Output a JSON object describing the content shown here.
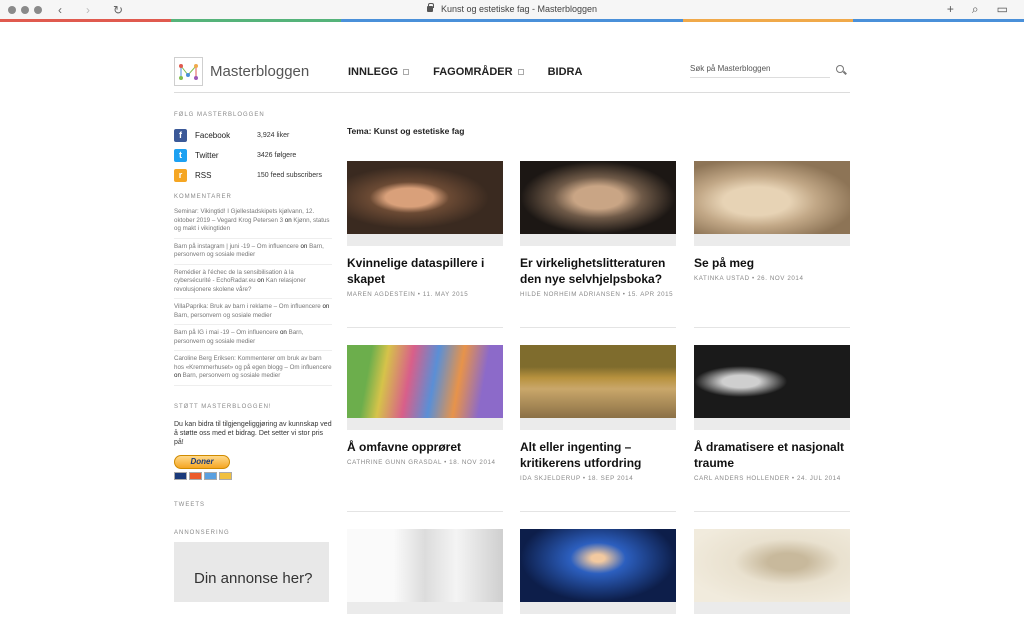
{
  "browser": {
    "tab_title": "Kunst og estetiske fag - Masterbloggen",
    "back": "‹",
    "forward": "›",
    "reload": "↻",
    "new_tab": "+",
    "search": "⌕",
    "sidebar_toggle": "▭",
    "colorbar": [
      "#e05a4f",
      "#55b37a",
      "#4a90d9",
      "#4a90d9",
      "#f0a94a",
      "#4a90d9"
    ]
  },
  "site": {
    "name": "Masterbloggen",
    "nav": [
      {
        "label": "INNLEGG"
      },
      {
        "label": "FAGOMRÅDER"
      },
      {
        "label": "BIDRA"
      }
    ],
    "search_placeholder": "Søk på Masterbloggen"
  },
  "sidebar": {
    "follow_heading": "FØLG MASTERBLOGGEN",
    "follow": [
      {
        "name": "Facebook",
        "count": "3,924 liker",
        "icon": "f",
        "color": "#3b5998"
      },
      {
        "name": "Twitter",
        "count": "3426 følgere",
        "icon": "t",
        "color": "#1da1f2"
      },
      {
        "name": "RSS",
        "count": "150 feed subscribers",
        "icon": "r",
        "color": "#f5a623"
      }
    ],
    "comments_heading": "KOMMENTARER",
    "comments": [
      {
        "author": "Seminar: Vikingtid! I Gjellestadskipets kjølvann, 12. oktober 2019 – Vegard Krog Petersen 3",
        "on": "on",
        "post": "Kjønn, status og makt i vikingtiden"
      },
      {
        "author": "Barn på instagram | juni -19 – Om influencere",
        "on": "on",
        "post": "Barn, personvern og sosiale medier"
      },
      {
        "author": "Remédier à l'échec de la sensibilisation à la cybersécurité - EchoRadar.eu",
        "on": "on",
        "post": "Kan relasjoner revolusjonere skolene våre?"
      },
      {
        "author": "VillaPaprika: Bruk av barn i reklame – Om influencere",
        "on": "on",
        "post": "Barn, personvern og sosiale medier"
      },
      {
        "author": "Barn på IG i mai -19 – Om influencere",
        "on": "on",
        "post": "Barn, personvern og sosiale medier"
      },
      {
        "author": "Caroline Berg Eriksen: Kommenterer om bruk av barn hos «Kremmerhuset» og på egen blogg – Om influencere",
        "on": "on",
        "post": "Barn, personvern og sosiale medier"
      }
    ],
    "support_heading": "STØTT MASTERBLOGGEN!",
    "support_text": "Du kan bidra til tilgjengeliggjøring av kunnskap ved å støtte oss med et bidrag. Det setter vi stor pris på!",
    "donate_label": "Doner",
    "tweets_heading": "TWEETS",
    "ads_heading": "ANNONSERING",
    "ad_text": "Din annonse her?"
  },
  "main": {
    "tema": "Tema: Kunst og estetiske fag",
    "posts": [
      {
        "title": "Kvinnelige dataspillere i skapet",
        "meta": "MAREN AGDESTEIN • 11. MAY 2015",
        "thumb": "woman-portrait"
      },
      {
        "title": "Er virkelighetslitteraturen den nye selvhjelpsboka?",
        "meta": "HILDE NORHEIM ADRIANSEN • 15. APR 2015",
        "thumb": "man-portrait"
      },
      {
        "title": "Se på meg",
        "meta": "KATINKA USTAD • 26. NOV 2014",
        "thumb": "vintage-photo"
      },
      {
        "title": "Å omfavne opprøret",
        "meta": "CATHRINE GUNN GRASDAL • 18. NOV 2014",
        "thumb": "graffiti"
      },
      {
        "title": "Alt eller ingenting – kritikerens utfordring",
        "meta": "IDA SKJELDERUP • 18. SEP 2014",
        "thumb": "boxes-room"
      },
      {
        "title": "Å dramatisere et nasjonalt traume",
        "meta": "CARL ANDERS HOLLENDER • 24. JUL 2014",
        "thumb": "theatre-stage"
      },
      {
        "title": "",
        "meta": "",
        "thumb": "comic-drawing"
      },
      {
        "title": "",
        "meta": "",
        "thumb": "concert-stage"
      },
      {
        "title": "",
        "meta": "",
        "thumb": "anatomy-print"
      }
    ]
  }
}
